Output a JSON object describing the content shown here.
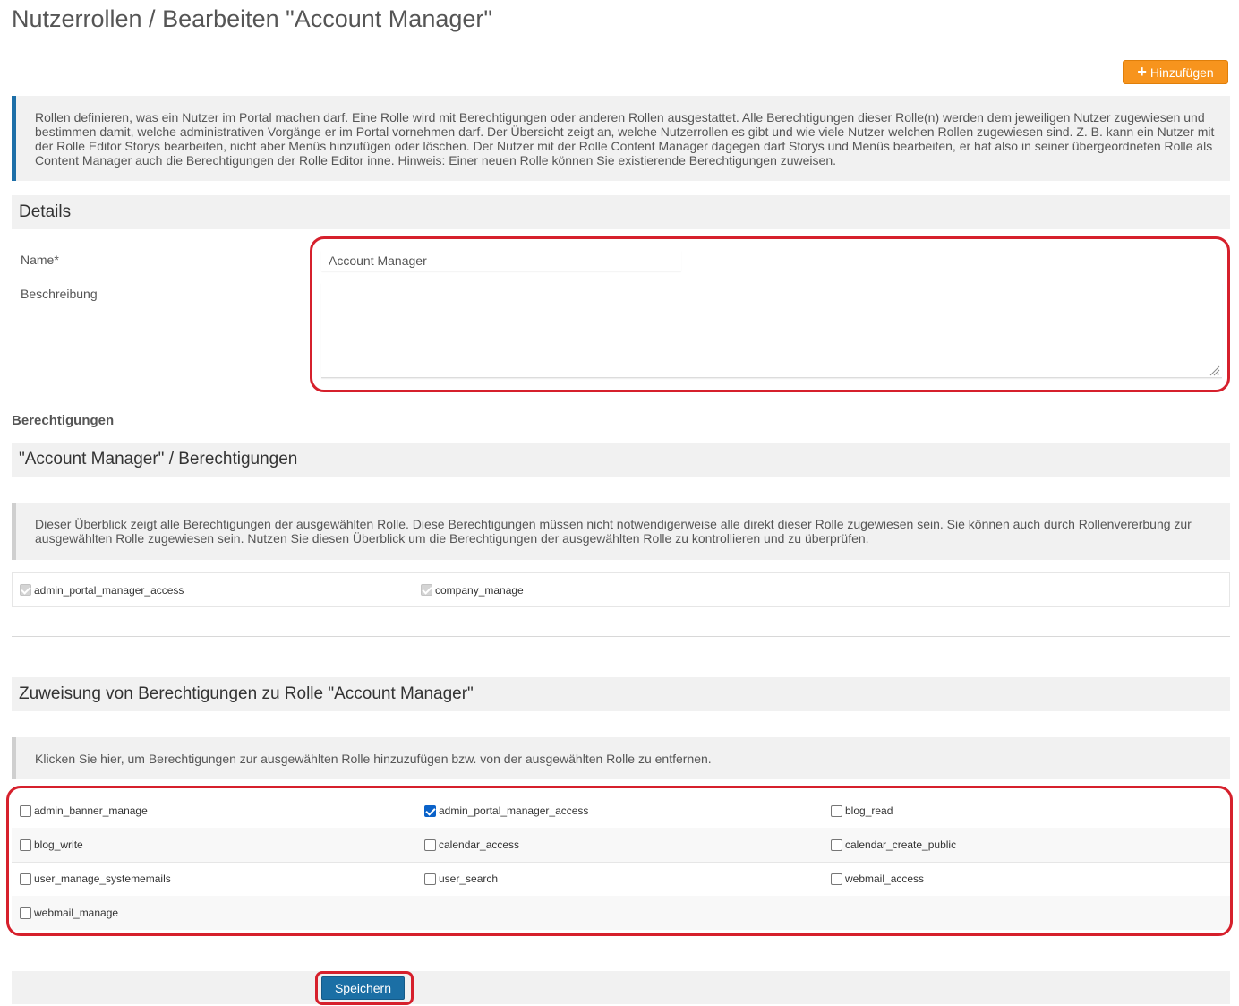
{
  "page": {
    "title": "Nutzerrollen / Bearbeiten \"Account Manager\"",
    "add_button_label": "Hinzufügen"
  },
  "intro_info": "Rollen definieren, was ein Nutzer im Portal machen darf. Eine Rolle wird mit Berechtigungen oder anderen Rollen ausgestattet. Alle Berechtigungen dieser Rolle(n) werden dem jeweiligen Nutzer zugewiesen und bestimmen damit, welche administrativen Vorgänge er im Portal vornehmen darf. Der Übersicht zeigt an, welche Nutzerrollen es gibt und wie viele Nutzer welchen Rollen zugewiesen sind. Z. B. kann ein Nutzer mit der Rolle Editor Storys bearbeiten, nicht aber Menüs hinzufügen oder löschen. Der Nutzer mit der Rolle Content Manager dagegen darf Storys und Menüs bearbeiten, er hat also in seiner übergeordneten Rolle als Content Manager auch die Berechtigungen der Rolle Editor inne. Hinweis: Einer neuen Rolle können Sie existierende Berechtigungen zuweisen.",
  "details": {
    "header": "Details",
    "name_label": "Name*",
    "name_value": "Account Manager",
    "description_label": "Beschreibung",
    "description_value": ""
  },
  "permissions_heading": "Berechtigungen",
  "overview": {
    "header": "\"Account Manager\" / Berechtigungen",
    "info": "Dieser Überblick zeigt alle Berechtigungen der ausgewählten Rolle. Diese Berechtigungen müssen nicht notwendigerweise alle direkt dieser Rolle zugewiesen sein. Sie können auch durch Rollenvererbung zur ausgewählten Rolle zugewiesen sein. Nutzen Sie diesen Überblick um die Berechtigungen der ausgewählten Rolle zu kontrollieren und zu überprüfen.",
    "items": [
      {
        "label": "admin_portal_manager_access",
        "checked": true
      },
      {
        "label": "company_manage",
        "checked": true
      }
    ]
  },
  "assignment": {
    "header": "Zuweisung von Berechtigungen zu Rolle \"Account Manager\"",
    "info": "Klicken Sie hier, um Berechtigungen zur ausgewählten Rolle hinzuzufügen bzw. von der ausgewählten Rolle zu entfernen.",
    "items": [
      {
        "label": "admin_banner_manage",
        "checked": false
      },
      {
        "label": "admin_portal_manager_access",
        "checked": true
      },
      {
        "label": "blog_read",
        "checked": false
      },
      {
        "label": "blog_write",
        "checked": false
      },
      {
        "label": "calendar_access",
        "checked": false
      },
      {
        "label": "calendar_create_public",
        "checked": false
      },
      {
        "label": "user_manage_systememails",
        "checked": false
      },
      {
        "label": "user_search",
        "checked": false
      },
      {
        "label": "webmail_access",
        "checked": false
      },
      {
        "label": "webmail_manage",
        "checked": false
      }
    ]
  },
  "save_button_label": "Speichern",
  "colors": {
    "accent_orange": "#f7941d",
    "primary_blue": "#1b6fa5",
    "info_border_blue": "#1d6fa8",
    "highlight_red": "#d6202c"
  }
}
